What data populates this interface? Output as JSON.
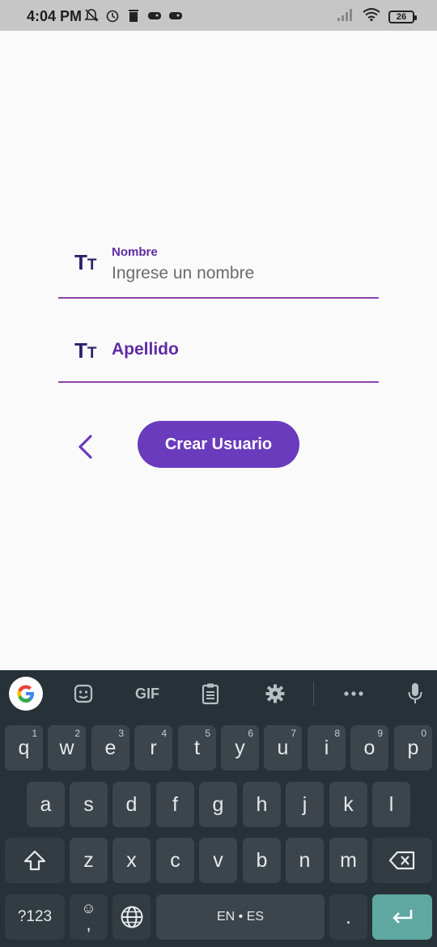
{
  "status_bar": {
    "time": "4:04 PM",
    "battery": "26"
  },
  "form": {
    "nombre": {
      "label": "Nombre",
      "placeholder": "Ingrese un nombre",
      "icon_big": "T",
      "icon_small": "T"
    },
    "apellido": {
      "label": "Apellido",
      "icon_big": "T",
      "icon_small": "T"
    },
    "create_button_label": "Crear Usuario"
  },
  "colors": {
    "accent": "#6a3bbd",
    "label": "#5e2ba4",
    "underline": "#8e44ad",
    "keyboard_bg": "#263238",
    "enter_key": "#5fa8a1"
  },
  "keyboard": {
    "toolbar": {
      "gif_label": "GIF",
      "icons": [
        "google-icon",
        "sticker-icon",
        "gif-icon",
        "clipboard-icon",
        "gear-icon",
        "more-icon",
        "mic-icon"
      ]
    },
    "row1": [
      {
        "key": "q",
        "hint": "1"
      },
      {
        "key": "w",
        "hint": "2"
      },
      {
        "key": "e",
        "hint": "3"
      },
      {
        "key": "r",
        "hint": "4"
      },
      {
        "key": "t",
        "hint": "5"
      },
      {
        "key": "y",
        "hint": "6"
      },
      {
        "key": "u",
        "hint": "7"
      },
      {
        "key": "i",
        "hint": "8"
      },
      {
        "key": "o",
        "hint": "9"
      },
      {
        "key": "p",
        "hint": "0"
      }
    ],
    "row2": [
      "a",
      "s",
      "d",
      "f",
      "g",
      "h",
      "j",
      "k",
      "l"
    ],
    "row3": [
      "z",
      "x",
      "c",
      "v",
      "b",
      "n",
      "m"
    ],
    "symbols_label": "?123",
    "emoji_label": "☺",
    "comma_label": ",",
    "space_label": "EN • ES",
    "period_label": "."
  }
}
